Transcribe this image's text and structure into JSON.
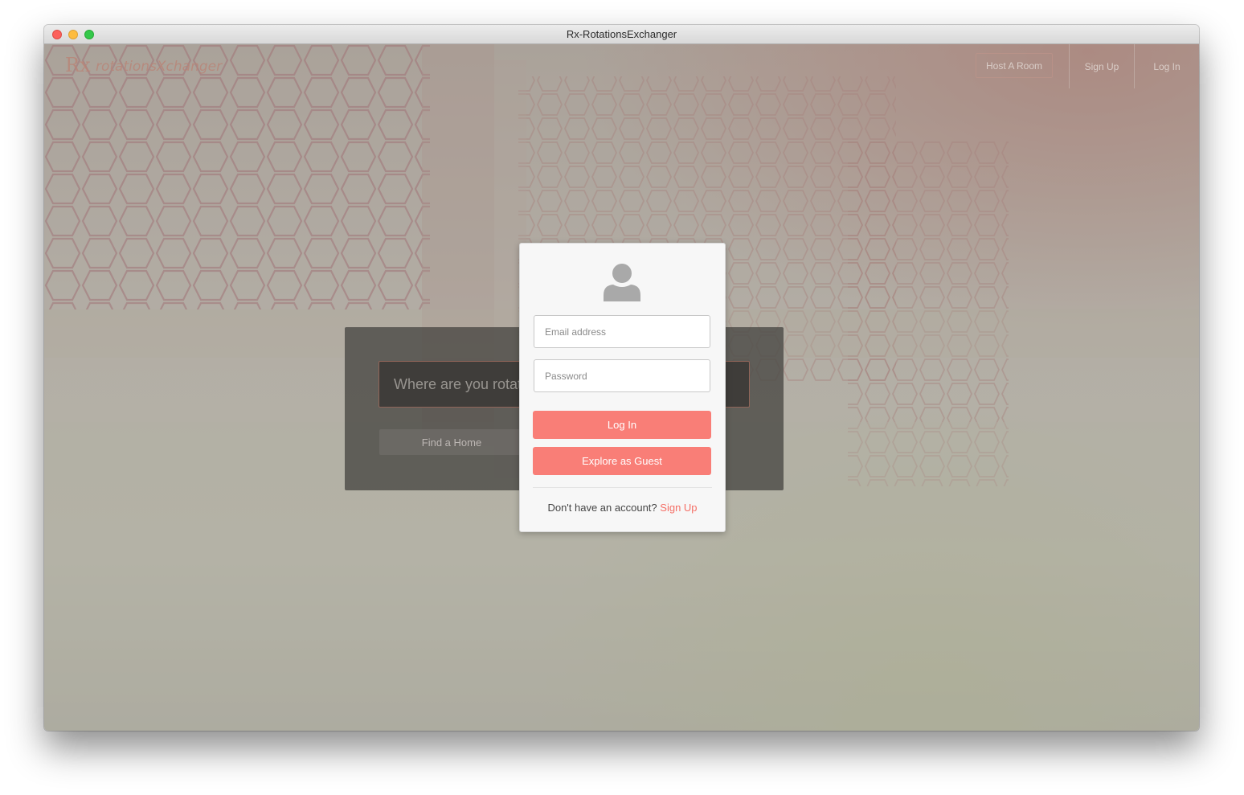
{
  "window": {
    "title": "Rx-RotationsExchanger"
  },
  "nav": {
    "logo_mark": "Rx",
    "logo_text": "rotationsXchanger",
    "host_label": "Host A Room",
    "signup_label": "Sign Up",
    "login_label": "Log In"
  },
  "search": {
    "placeholder": "Where are you rotating?",
    "button_label": "Find a Home"
  },
  "modal": {
    "email_placeholder": "Email address",
    "password_placeholder": "Password",
    "login_label": "Log In",
    "guest_label": "Explore as Guest",
    "prompt": "Don't have an account?",
    "signup_link": "Sign Up"
  },
  "colors": {
    "accent": "#f97e77",
    "link": "#f56f66"
  }
}
